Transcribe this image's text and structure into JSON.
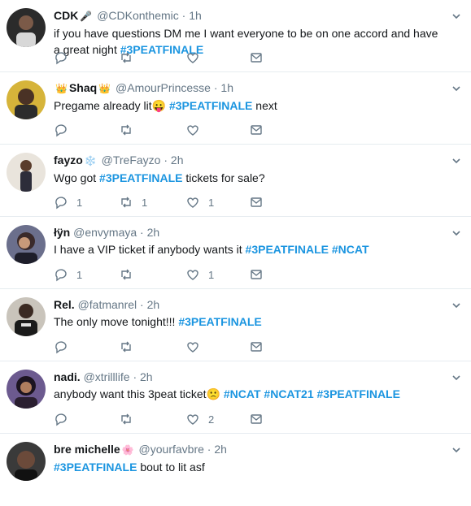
{
  "tweets": [
    {
      "name": "CDK",
      "badge": "🎤",
      "handle": "@CDKonthemic",
      "dot": "·",
      "time": "1h",
      "text_before": "if you have questions DM me I want everyone to be on one accord and have a great night ",
      "hashtag1": "#3PEATFINALE",
      "text_after": "",
      "replies": "",
      "retweets": "",
      "likes": ""
    },
    {
      "name": "Shaq",
      "badge": "👑",
      "handle": "@AmourPrincesse",
      "dot": "·",
      "time": "1h",
      "text_before": "Pregame already lit",
      "emoji": "😛",
      "hashtag1": "#3PEATFINALE",
      "text_after": " next",
      "replies": "",
      "retweets": "",
      "likes": ""
    },
    {
      "name": "fayzo",
      "badge": "❄️",
      "handle": "@TreFayzo",
      "dot": "·",
      "time": "2h",
      "text_before": "Wgo got ",
      "hashtag1": "#3PEATFINALE",
      "text_after": " tickets for sale?",
      "replies": "1",
      "retweets": "1",
      "likes": "1"
    },
    {
      "name": "łÿn",
      "handle": "@envymaya",
      "dot": "·",
      "time": "2h",
      "text_before": "I have a VIP ticket if anybody wants it ",
      "hashtag1": "#3PEATFINALE",
      "hashtag2": "#NCAT",
      "text_after": "",
      "replies": "1",
      "retweets": "",
      "likes": "1"
    },
    {
      "name": "Rel.",
      "handle": "@fatmanrel",
      "dot": "·",
      "time": "2h",
      "text_before": "The only move tonight!!!  ",
      "hashtag1": "#3PEATFINALE",
      "text_after": "",
      "replies": "",
      "retweets": "",
      "likes": ""
    },
    {
      "name": "nadi.",
      "handle": "@xtrilllife",
      "dot": "·",
      "time": "2h",
      "text_before": "anybody want this 3peat ticket",
      "emoji": "🙁",
      "hashtag_a": "#NCAT",
      "hashtag_b": "#NCAT21",
      "hashtag1": "#3PEATFINALE",
      "text_after": "",
      "replies": "",
      "retweets": "",
      "likes": "2"
    },
    {
      "name": "bre michelle",
      "badge": "🌸",
      "handle": "@yourfavbre",
      "dot": "·",
      "time": "2h",
      "text_before": "",
      "hashtag1": "#3PEATFINALE",
      "text_after": " bout to lit asf"
    }
  ],
  "colors": {
    "link": "#1b95e0",
    "muted": "#657786",
    "border": "#e6ecf0"
  },
  "icons": [
    "reply-icon",
    "retweet-icon",
    "like-icon",
    "direct-message-icon",
    "caret-down-icon"
  ]
}
